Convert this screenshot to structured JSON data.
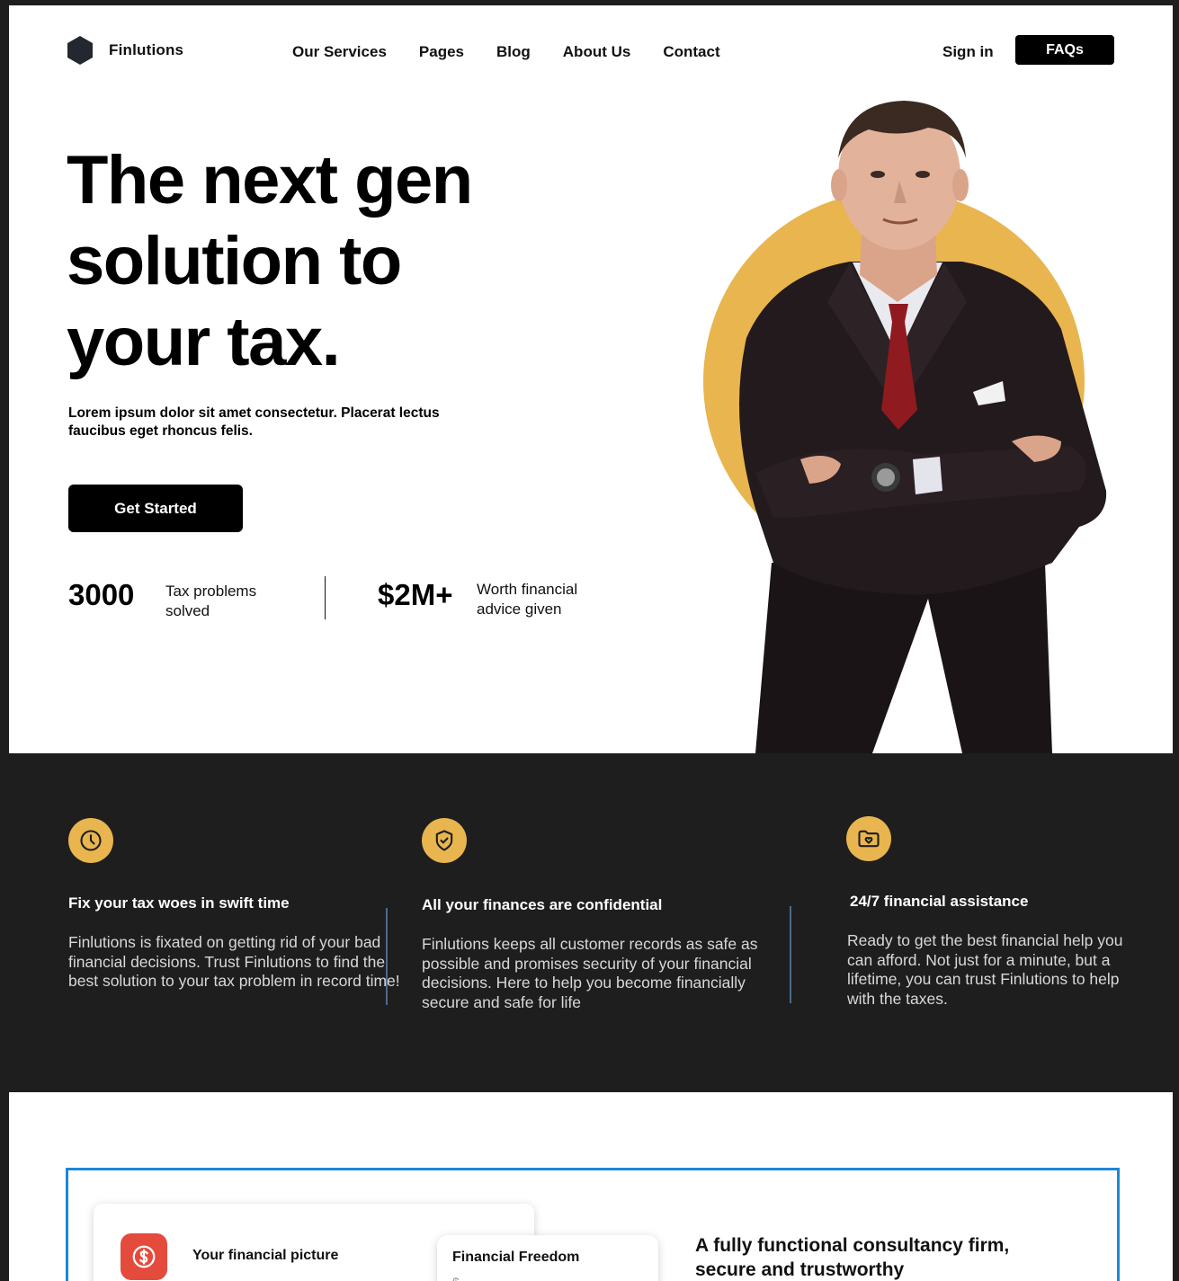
{
  "brand": {
    "name": "Finlutions"
  },
  "nav": {
    "items": [
      "Our Services",
      "Pages",
      "Blog",
      "About Us",
      "Contact"
    ]
  },
  "header": {
    "signin_label": "Sign in",
    "faq_label": "FAQs"
  },
  "hero": {
    "title_lines": [
      "The next gen",
      "solution to",
      "your tax."
    ],
    "subtitle": "Lorem ipsum dolor sit amet consectetur. Placerat lectus faucibus eget rhoncus felis.",
    "cta_label": "Get Started",
    "stats": [
      {
        "value": "3000",
        "label": "Tax problems solved"
      },
      {
        "value": "$2M+",
        "label": "Worth financial advice given"
      }
    ]
  },
  "features": [
    {
      "icon": "clock-icon",
      "title": "Fix your tax woes in swift time",
      "text": "Finlutions is fixated on getting rid of your bad financial decisions. Trust Finlutions to find the best solution to your tax problem in record time!"
    },
    {
      "icon": "shield-check-icon",
      "title": "All your finances are confidential",
      "text": "Finlutions keeps all customer records as safe as possible and promises security of your financial decisions. Here to help you become financially secure and safe for life"
    },
    {
      "icon": "folder-heart-icon",
      "title": "24/7 financial assistance",
      "text": "Ready to get the best financial help you can afford. Not just for a minute, but a lifetime, you can trust Finlutions to help with the taxes."
    }
  ],
  "colors": {
    "accent": "#e8b54f",
    "dark": "#1e1e1e",
    "frame": "#1d87d6",
    "badge": "#e54b3c"
  },
  "lower": {
    "card1_title": "Your financial picture",
    "card2_title": "Financial Freedom",
    "card2_value": "$ - - - -",
    "heading": "A fully functional consultancy firm, secure and trustworthy"
  }
}
